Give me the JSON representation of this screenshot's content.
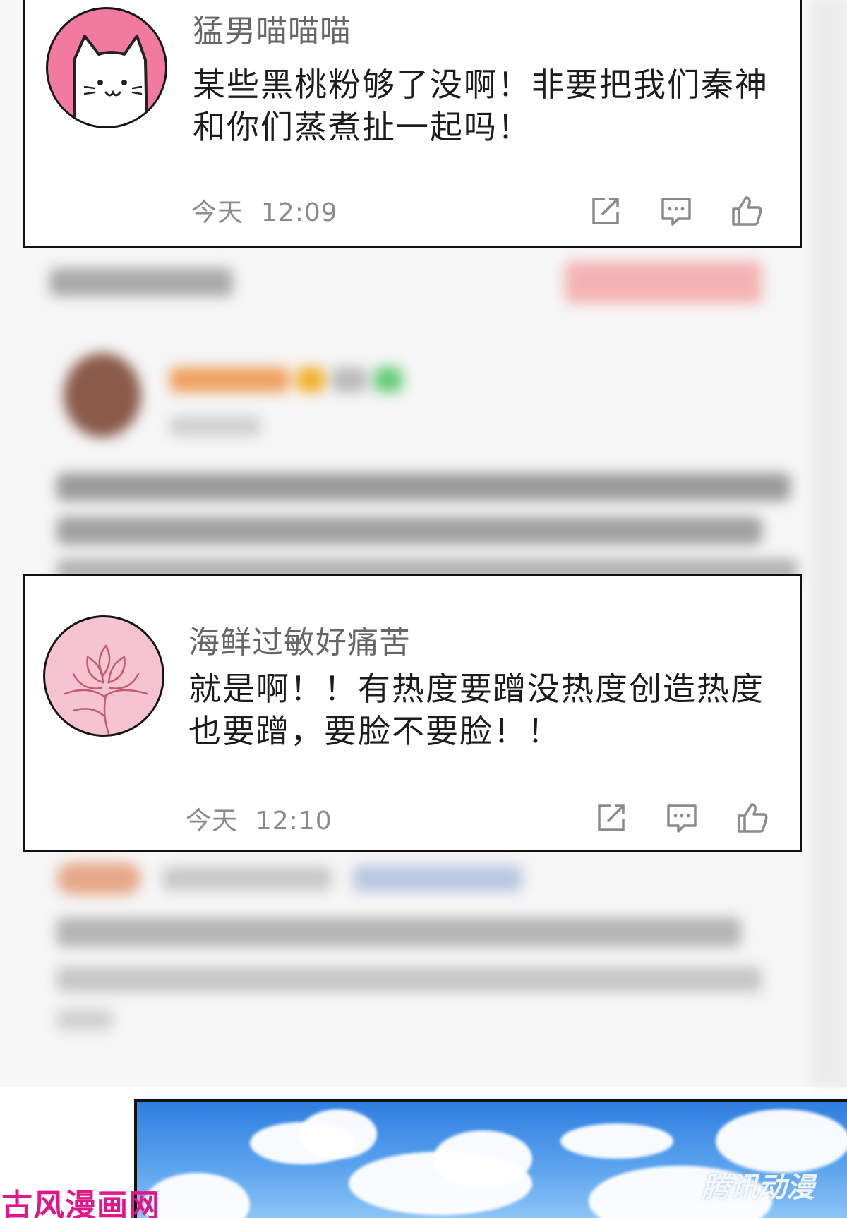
{
  "comments": [
    {
      "username": "猛男喵喵喵",
      "text": "某些黑桃粉够了没啊！非要把我们秦神和你们蒸煮扯一起吗！",
      "date": "今天",
      "time": "12:09",
      "avatar_icon": "cat-face-icon",
      "avatar_color": "#f27aa0"
    },
    {
      "username": "海鲜过敏好痛苦",
      "text": "就是啊！！有热度要蹭没热度创造热度也要蹭，要脸不要脸！！",
      "date": "今天",
      "time": "12:10",
      "avatar_icon": "flower-sketch-icon",
      "avatar_color": "#f6c3d1"
    }
  ],
  "action_icons": [
    "share-icon",
    "reply-icon",
    "like-icon"
  ],
  "watermarks": {
    "left": "古风漫画网",
    "right": "腾讯动漫"
  },
  "colors": {
    "card_border": "#111111",
    "username": "#666666",
    "text": "#1c1c1c",
    "watermark_left": "#e0178a"
  }
}
